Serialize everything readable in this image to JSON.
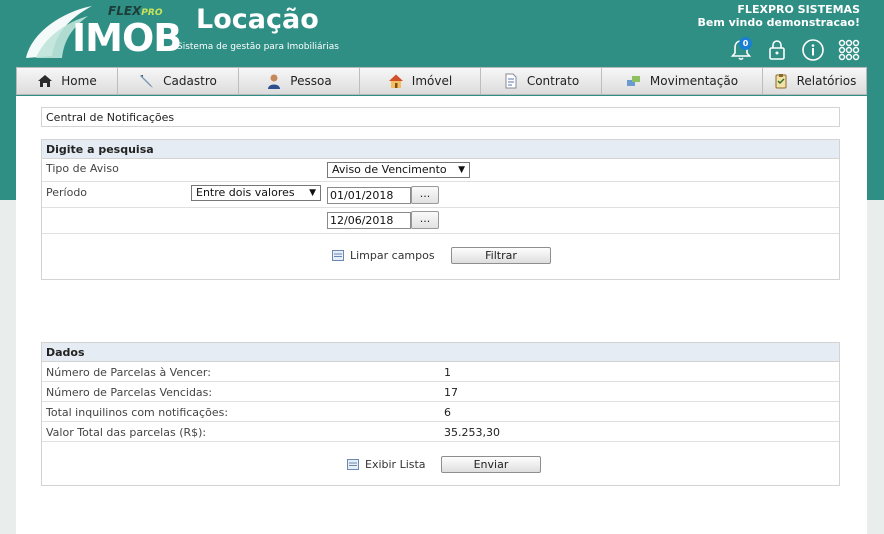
{
  "brand": {
    "logo_text": "IMOB",
    "flex_text": "FLEX",
    "flex_pro": "PRO",
    "product": "Locação",
    "tagline": "Sistema de gestão para Imobiliárias"
  },
  "header": {
    "company": "FLEXPRO SISTEMAS",
    "welcome": "Bem vindo demonstracao!",
    "notification_count": "0"
  },
  "nav": {
    "items": [
      {
        "label": "Home",
        "icon": "home-icon"
      },
      {
        "label": "Cadastro",
        "icon": "pen-icon"
      },
      {
        "label": "Pessoa",
        "icon": "person-icon"
      },
      {
        "label": "Imóvel",
        "icon": "house-icon"
      },
      {
        "label": "Contrato",
        "icon": "document-icon"
      },
      {
        "label": "Movimentação",
        "icon": "transfer-icon"
      },
      {
        "label": "Relatórios",
        "icon": "clipboard-icon"
      }
    ]
  },
  "page": {
    "title": "Central de Notificações"
  },
  "search": {
    "heading": "Digite a pesquisa",
    "tipo_label": "Tipo de Aviso",
    "tipo_value": "Aviso de Vencimento",
    "periodo_label": "Período",
    "periodo_mode": "Entre dois valores",
    "date_start": "01/01/2018",
    "date_end": "12/06/2018",
    "picker_label": "...",
    "clear_label": "Limpar campos",
    "filter_label": "Filtrar"
  },
  "dados": {
    "heading": "Dados",
    "rows": [
      {
        "label": "Número de Parcelas à Vencer:",
        "value": "1"
      },
      {
        "label": "Número de Parcelas Vencidas:",
        "value": "17"
      },
      {
        "label": "Total inquilinos com notificações:",
        "value": "6"
      },
      {
        "label": "Valor Total das parcelas (R$):",
        "value": "35.253,30"
      }
    ],
    "list_label": "Exibir Lista",
    "send_label": "Enviar"
  },
  "colors": {
    "header": "#2f8f84",
    "section_head": "#e6ecf3"
  }
}
